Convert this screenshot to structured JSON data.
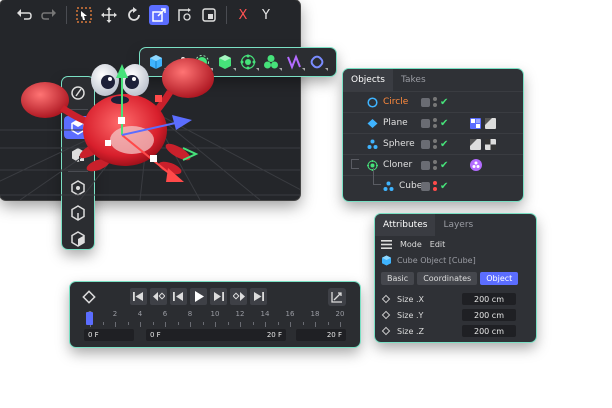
{
  "colors": {
    "accent": "#5b6dff",
    "green": "#46e27a",
    "panel_border": "#7ae0c4",
    "axis_x": "#ff5252"
  },
  "top_toolbar": {
    "icons": [
      "cube-primitive-icon",
      "spline-pen-icon",
      "subdivision-icon",
      "cube-generator-icon",
      "cloner-icon",
      "mograph-icon",
      "deformer-icon",
      "field-icon"
    ]
  },
  "left_toolbar": {
    "icons": [
      "live-select-icon",
      "model-mode-icon",
      "texture-mode-icon",
      "points-mode-icon",
      "edges-mode-icon",
      "polygons-mode-icon"
    ]
  },
  "viewport": {
    "axis_x": "X",
    "axis_y": "Y"
  },
  "objects_panel": {
    "tabs": [
      "Objects",
      "Takes"
    ],
    "rows": [
      {
        "name": "Circle",
        "color": "#ff8a3d"
      },
      {
        "name": "Plane",
        "color": "#e0e0e0"
      },
      {
        "name": "Sphere",
        "color": "#e0e0e0"
      },
      {
        "name": "Cloner",
        "color": "#e0e0e0"
      },
      {
        "name": "Cube",
        "color": "#e0e0e0"
      }
    ]
  },
  "attributes_panel": {
    "tabs": [
      "Attributes",
      "Layers"
    ],
    "menu": [
      "Mode",
      "Edit"
    ],
    "object_title": "Cube Object [Cube]",
    "subtabs": [
      "Basic",
      "Coordinates",
      "Object"
    ],
    "props": [
      {
        "label": "Size .X",
        "value": "200 cm"
      },
      {
        "label": "Size .Y",
        "value": "200 cm"
      },
      {
        "label": "Size .Z",
        "value": "200 cm"
      }
    ]
  },
  "timeline": {
    "ticks": [
      "0",
      "2",
      "4",
      "6",
      "8",
      "10",
      "12",
      "14",
      "16",
      "18",
      "20"
    ],
    "start_field": "0 F",
    "current_field": "0 F",
    "end_preview_field": "20 F",
    "end_field": "20 F"
  }
}
